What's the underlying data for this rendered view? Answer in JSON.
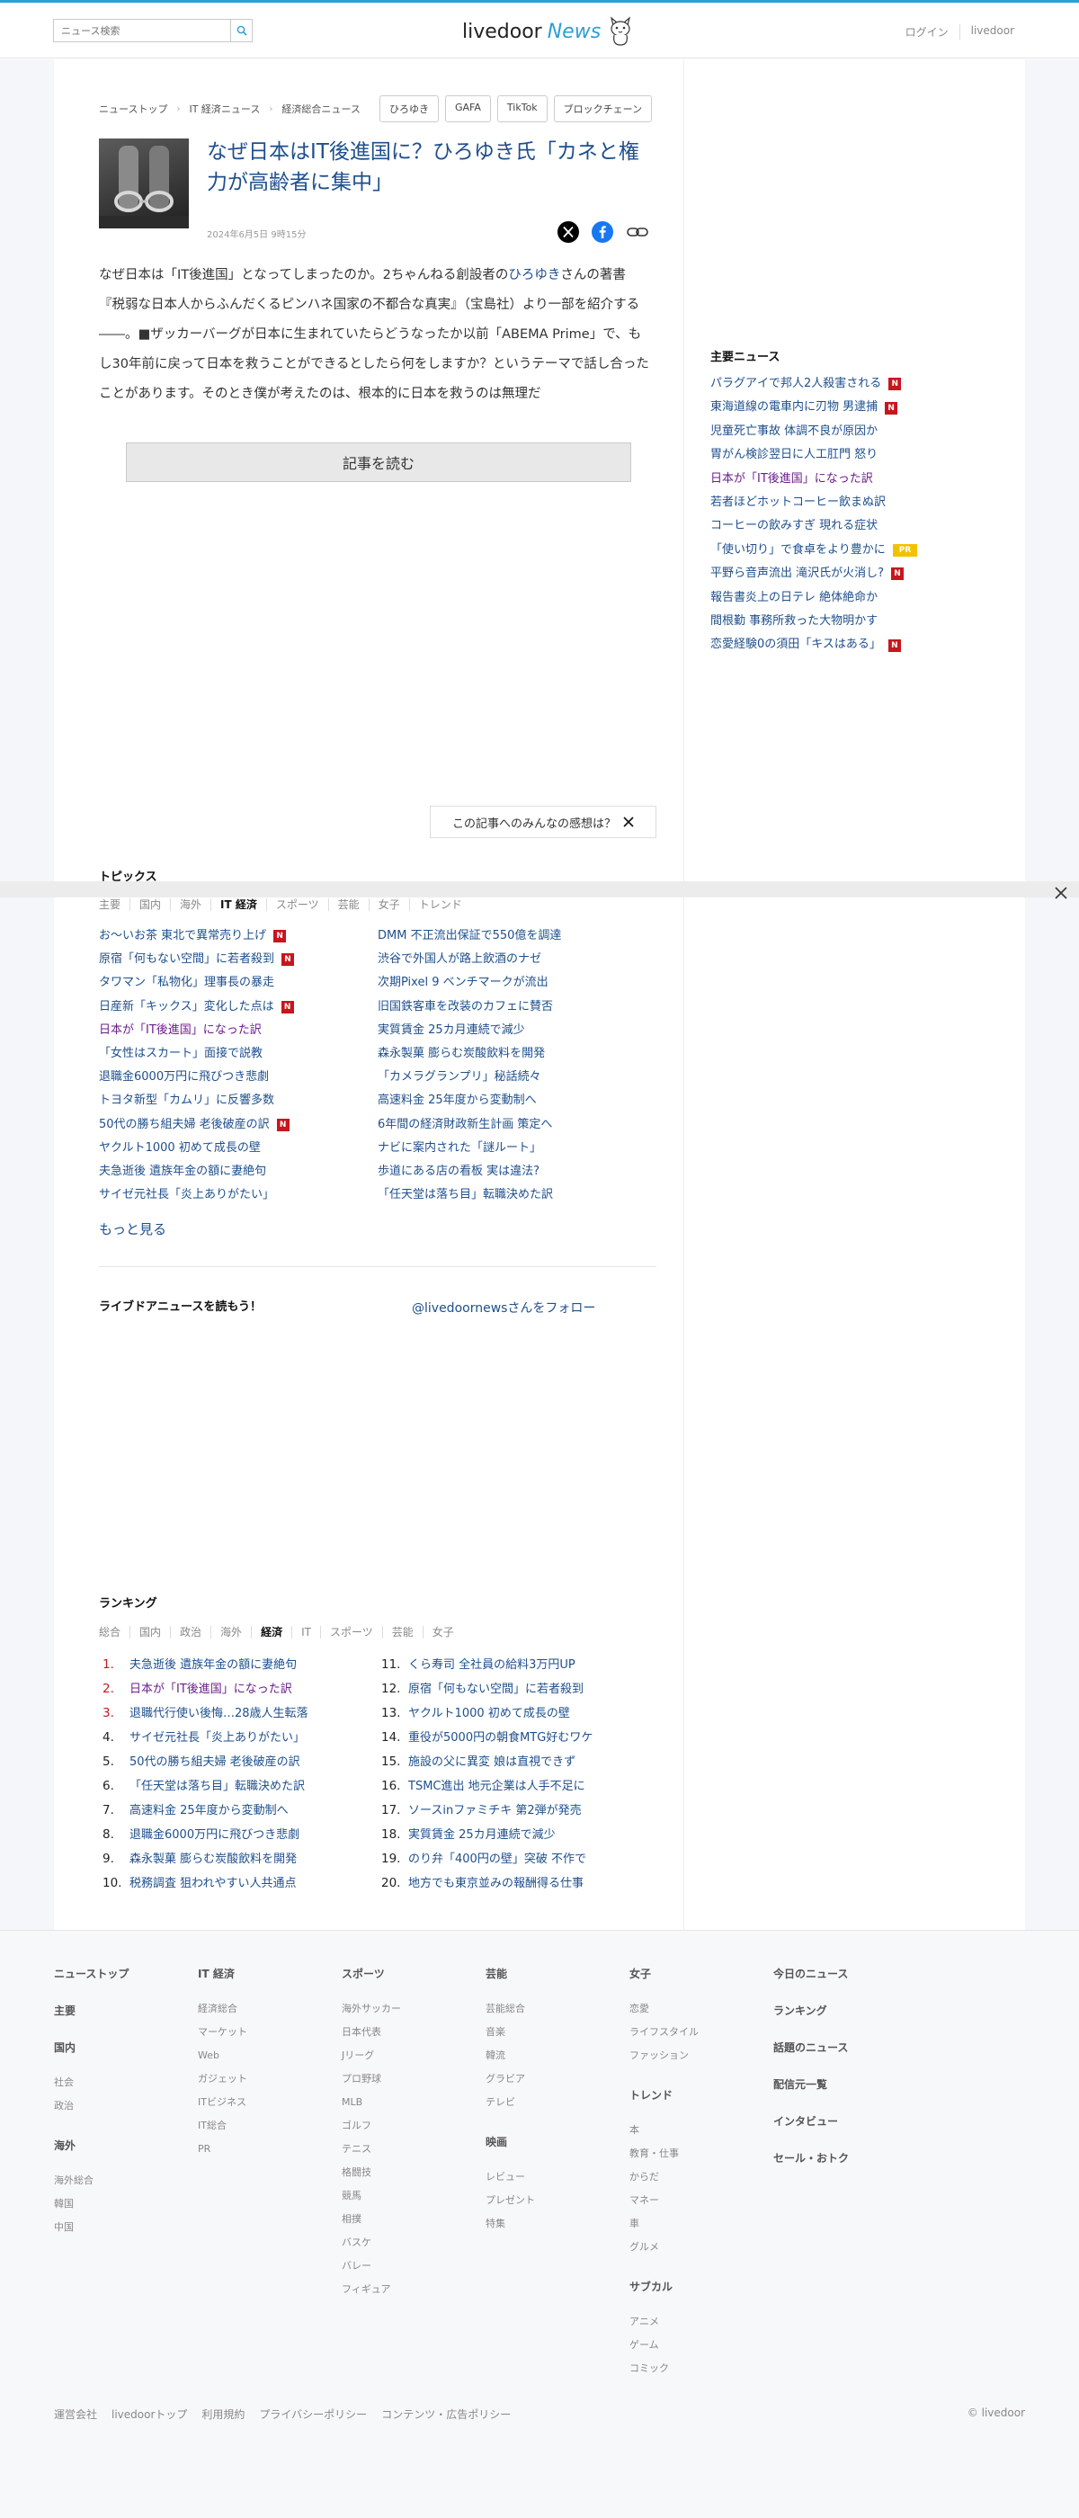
{
  "header": {
    "search_placeholder": "ニュース検索",
    "logo_livedoor": "livedoor",
    "logo_news": "News",
    "login": "ログイン",
    "livedoor_link": "livedoor"
  },
  "breadcrumb": [
    "ニューストップ",
    "IT 経済ニュース",
    "経済総合ニュース"
  ],
  "tags": [
    "ひろゆき",
    "GAFA",
    "TikTok",
    "ブロックチェーン"
  ],
  "article": {
    "title": "なぜ日本はIT後進国に？ひろゆき氏「カネと権力が高齢者に集中」",
    "date": "2024年6月5日 9時15分",
    "body_pre": "なぜ日本は「IT後進国」となってしまったのか。2ちゃんねる創設者の",
    "body_keyword": "ひろゆき",
    "body_post": "さんの著書『税弱な日本人からふんだくるピンハネ国家の不都合な真実』（宝島社）より一部を紹介する――。■ザッカーバーグが日本に生まれていたらどうなったか以前「ABEMA Prime」で、もし30年前に戻って日本を救うことができるとしたら何をしますか？というテーマで話し合ったことがあります。そのとき僕が考えたのは、根本的に日本を救うのは無理だ",
    "read_more": "記事を読む",
    "impression": "この記事へのみんなの感想は？"
  },
  "topics": {
    "title": "トピックス",
    "categories": [
      "主要",
      "国内",
      "海外",
      "IT 経済",
      "スポーツ",
      "芸能",
      "女子",
      "トレンド"
    ],
    "active_index": 3,
    "left": [
      {
        "text": "お〜いお茶 東北で異常売り上げ",
        "n": true
      },
      {
        "text": "原宿「何もない空間」に若者殺到",
        "n": true
      },
      {
        "text": "タワマン「私物化」理事長の暴走",
        "n": false
      },
      {
        "text": "日産新「キックス」変化した点は",
        "n": true
      },
      {
        "text": "日本が「IT後進国」になった訳",
        "n": false,
        "visited": true
      },
      {
        "text": "「女性はスカート」面接で説教",
        "n": false
      },
      {
        "text": "退職金6000万円に飛びつき悲劇",
        "n": false
      },
      {
        "text": "トヨタ新型「カムリ」に反響多数",
        "n": false
      },
      {
        "text": "50代の勝ち組夫婦 老後破産の訳",
        "n": true
      },
      {
        "text": "ヤクルト1000 初めて成長の壁",
        "n": false
      },
      {
        "text": "夫急逝後 遺族年金の額に妻絶句",
        "n": false
      },
      {
        "text": "サイゼ元社長「炎上ありがたい」",
        "n": false
      }
    ],
    "right": [
      {
        "text": "DMM 不正流出保証で550億を調達"
      },
      {
        "text": "渋谷で外国人が路上飲酒のナゼ"
      },
      {
        "text": "次期Pixel 9 ベンチマークが流出"
      },
      {
        "text": "旧国鉄客車を改装のカフェに賛否"
      },
      {
        "text": "実質賃金 25カ月連続で減少"
      },
      {
        "text": "森永製菓 膨らむ炭酸飲料を開発"
      },
      {
        "text": "「カメラグランプリ」秘話続々"
      },
      {
        "text": "高速料金 25年度から変動制へ"
      },
      {
        "text": "6年間の経済財政新生計画 策定へ"
      },
      {
        "text": "ナビに案内された「謎ルート」"
      },
      {
        "text": "歩道にある店の看板 実は違法?"
      },
      {
        "text": "「任天堂は落ち目」転職決めた訳"
      }
    ],
    "more": "もっと見る"
  },
  "livedoor_anime": {
    "title": "ライブドアニュースを読もう！",
    "follow": "@livedoornewsさんをフォロー"
  },
  "ranking": {
    "title": "ランキング",
    "categories": [
      "総合",
      "国内",
      "政治",
      "海外",
      "経済",
      "IT",
      "スポーツ",
      "芸能",
      "女子"
    ],
    "active_index": 4,
    "left": [
      "夫急逝後 遺族年金の額に妻絶句",
      "日本が「IT後進国」になった訳",
      "退職代行使い後悔…28歳人生転落",
      "サイゼ元社長「炎上ありがたい」",
      "50代の勝ち組夫婦 老後破産の訳",
      "「任天堂は落ち目」転職決めた訳",
      "高速料金 25年度から変動制へ",
      "退職金6000万円に飛びつき悲劇",
      "森永製菓 膨らむ炭酸飲料を開発",
      "税務調査 狙われやすい人共通点"
    ],
    "right": [
      "くら寿司 全社員の給料3万円UP",
      "原宿「何もない空間」に若者殺到",
      "ヤクルト1000 初めて成長の壁",
      "重役が5000円の朝食MTG好むワケ",
      "施設の父に異変 娘は直視できず",
      "TSMC進出 地元企業は人手不足に",
      "ソースinファミチキ 第2弾が発売",
      "実質賃金 25カ月連続で減少",
      "のり弁「400円の壁」突破 不作で",
      "地方でも東京並みの報酬得る仕事"
    ]
  },
  "sidebar": {
    "title": "主要ニュース",
    "items": [
      {
        "text": "パラグアイで邦人2人殺害される",
        "badge": "N"
      },
      {
        "text": "東海道線の電車内に刃物 男逮捕",
        "badge": "N"
      },
      {
        "text": "児童死亡事故 体調不良が原因か",
        "badge": ""
      },
      {
        "text": "胃がん検診翌日に人工肛門 怒り",
        "badge": ""
      },
      {
        "text": "日本が「IT後進国」になった訳",
        "badge": "",
        "visited": true
      },
      {
        "text": "若者ほどホットコーヒー飲まぬ訳",
        "badge": ""
      },
      {
        "text": "コーヒーの飲みすぎ 現れる症状",
        "badge": ""
      },
      {
        "text": "「使い切り」で食卓をより豊かに",
        "badge": "PR"
      },
      {
        "text": "平野ら音声流出 滝沢氏が火消し?",
        "badge": "N"
      },
      {
        "text": "報告書炎上の日テレ 絶体絶命か",
        "badge": ""
      },
      {
        "text": "間根勤 事務所救った大物明かす",
        "badge": ""
      },
      {
        "text": "恋愛経験0の須田「キスはある」",
        "badge": "N"
      }
    ]
  },
  "footer": {
    "columns": [
      {
        "groups": [
          {
            "head": "ニューストップ",
            "items": []
          },
          {
            "head": "主要",
            "items": []
          },
          {
            "head": "国内",
            "items": [
              "社会",
              "政治"
            ]
          },
          {
            "head": "海外",
            "items": [
              "海外総合",
              "韓国",
              "中国"
            ]
          }
        ]
      },
      {
        "groups": [
          {
            "head": "IT 経済",
            "items": [
              "経済総合",
              "マーケット",
              "Web",
              "ガジェット",
              "ITビジネス",
              "IT総合",
              "PR"
            ]
          }
        ]
      },
      {
        "groups": [
          {
            "head": "スポーツ",
            "items": [
              "海外サッカー",
              "日本代表",
              "Jリーグ",
              "プロ野球",
              "MLB",
              "ゴルフ",
              "テニス",
              "格闘技",
              "競馬",
              "相撲",
              "バスケ",
              "バレー",
              "フィギュア"
            ]
          }
        ]
      },
      {
        "groups": [
          {
            "head": "芸能",
            "items": [
              "芸能総合",
              "音楽",
              "韓流",
              "グラビア",
              "テレビ"
            ]
          },
          {
            "head": "映画",
            "items": [
              "レビュー",
              "プレゼント",
              "特集"
            ]
          }
        ]
      },
      {
        "groups": [
          {
            "head": "女子",
            "items": [
              "恋愛",
              "ライフスタイル",
              "ファッション"
            ]
          },
          {
            "head": "トレンド",
            "items": [
              "本",
              "教育・仕事",
              "からだ",
              "マネー",
              "車",
              "グルメ"
            ]
          },
          {
            "head": "サブカル",
            "items": [
              "アニメ",
              "ゲーム",
              "コミック"
            ]
          }
        ]
      },
      {
        "groups": [
          {
            "head": "今日のニュース",
            "items": []
          },
          {
            "head": "ランキング",
            "items": []
          },
          {
            "head": "話題のニュース",
            "items": []
          },
          {
            "head": "配信元一覧",
            "items": []
          },
          {
            "head": "インタビュー",
            "items": []
          },
          {
            "head": "セール・おトク",
            "items": []
          }
        ]
      }
    ],
    "bottom_links": [
      "運営会社",
      "livedoorトップ",
      "利用規約",
      "プライバシーポリシー",
      "コンテンツ・広告ポリシー"
    ],
    "copyright": "© livedoor"
  },
  "colors": {
    "link": "#1e4f8c",
    "accent": "#2a9fd6",
    "badge_new": "#c8161d",
    "badge_pr": "#f2c200",
    "visited": "#6b1e8c"
  }
}
